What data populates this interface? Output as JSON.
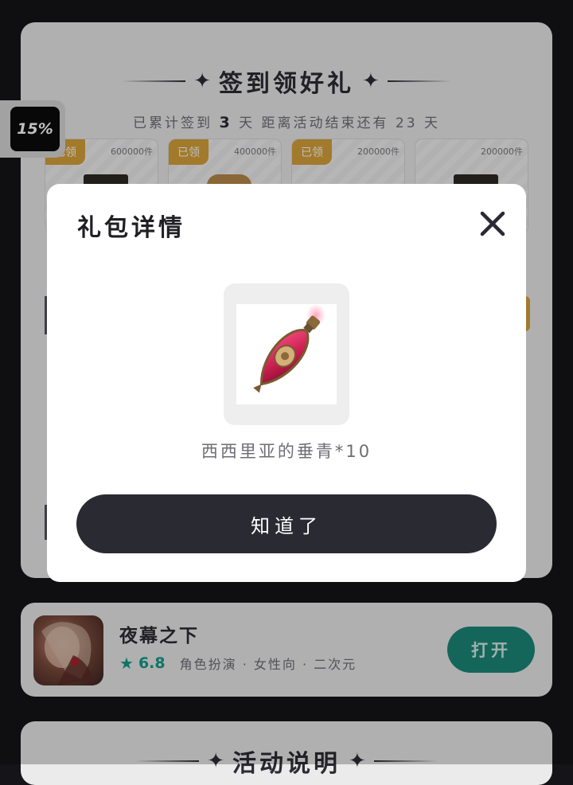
{
  "signin": {
    "title": "签到领好礼",
    "subtitle_prefix": "已累计签到",
    "days_signed": "3",
    "subtitle_mid": "天  距离活动结束还有",
    "days_left": "23",
    "subtitle_suffix": "天",
    "rewards": [
      {
        "badge": "已领",
        "count": "600000件"
      },
      {
        "badge": "已领",
        "count": "400000件"
      },
      {
        "badge": "已领",
        "count": "200000件"
      },
      {
        "badge": "",
        "count": "200000件"
      }
    ]
  },
  "side_chip": {
    "percent": "15%"
  },
  "modal": {
    "title": "礼包详情",
    "item_name": "西西里亚的垂青*10",
    "confirm_label": "知道了",
    "close_icon": "close-icon"
  },
  "game": {
    "name": "夜幕之下",
    "score": "6.8",
    "tags": "角色扮演 · 女性向 · 二次元",
    "open_label": "打开"
  },
  "rules": {
    "title": "活动说明"
  },
  "colors": {
    "accent_gold": "#d9a33a",
    "accent_teal": "#1d8878",
    "button_dark": "#2a2a33",
    "card_bg": "#ebebeb"
  }
}
